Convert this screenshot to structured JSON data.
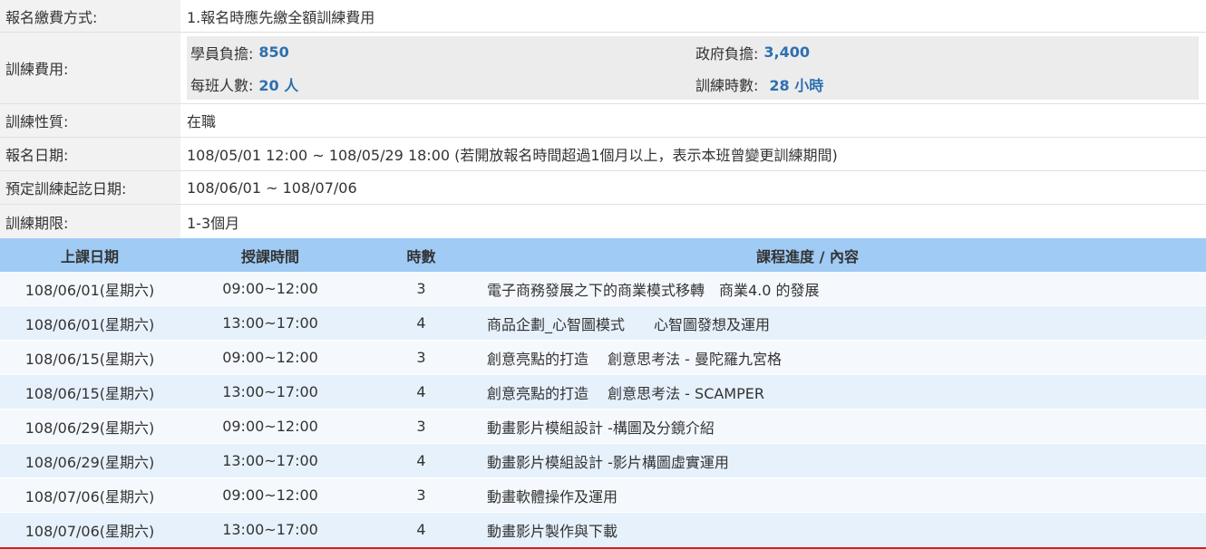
{
  "info": [
    {
      "label": "報名繳費方式:",
      "value": "1.報名時應先繳全額訓練費用"
    },
    {
      "label": "訓練性質:",
      "value": "在職"
    },
    {
      "label": "報名日期:",
      "value": "108/05/01 12:00 ~ 108/05/29 18:00 (若開放報名時間超過1個月以上，表示本班曾變更訓練期間)"
    },
    {
      "label": "預定訓練起訖日期:",
      "value": "108/06/01 ~ 108/07/06"
    },
    {
      "label": "訓練期限:",
      "value": "1-3個月"
    }
  ],
  "fee": {
    "label": "訓練費用:",
    "student_label": "學員負擔:",
    "student_value": "850",
    "gov_label": "政府負擔:",
    "gov_value": "3,400",
    "class_size_label": "每班人數:",
    "class_size_value": "20 人",
    "hours_label": "訓練時數:",
    "hours_value": "28 小時"
  },
  "schedule": {
    "headers": [
      "上課日期",
      "授課時間",
      "時數",
      "課程進度 / 內容"
    ],
    "rows": [
      [
        "108/06/01(星期六)",
        "09:00~12:00",
        "3",
        "電子商務發展之下的商業模式移轉　商業4.0 的發展"
      ],
      [
        "108/06/01(星期六)",
        "13:00~17:00",
        "4",
        "商品企劃_心智圖模式　　心智圖發想及運用"
      ],
      [
        "108/06/15(星期六)",
        "09:00~12:00",
        "3",
        "創意亮點的打造　 創意思考法 - 曼陀羅九宮格"
      ],
      [
        "108/06/15(星期六)",
        "13:00~17:00",
        "4",
        "創意亮點的打造　 創意思考法 - SCAMPER"
      ],
      [
        "108/06/29(星期六)",
        "09:00~12:00",
        "3",
        "動畫影片模組設計 -構圖及分鏡介紹"
      ],
      [
        "108/06/29(星期六)",
        "13:00~17:00",
        "4",
        "動畫影片模組設計 -影片構圖虛實運用"
      ],
      [
        "108/07/06(星期六)",
        "09:00~12:00",
        "3",
        "動畫軟體操作及運用"
      ],
      [
        "108/07/06(星期六)",
        "13:00~17:00",
        "4",
        "動畫影片製作與下載"
      ]
    ]
  }
}
